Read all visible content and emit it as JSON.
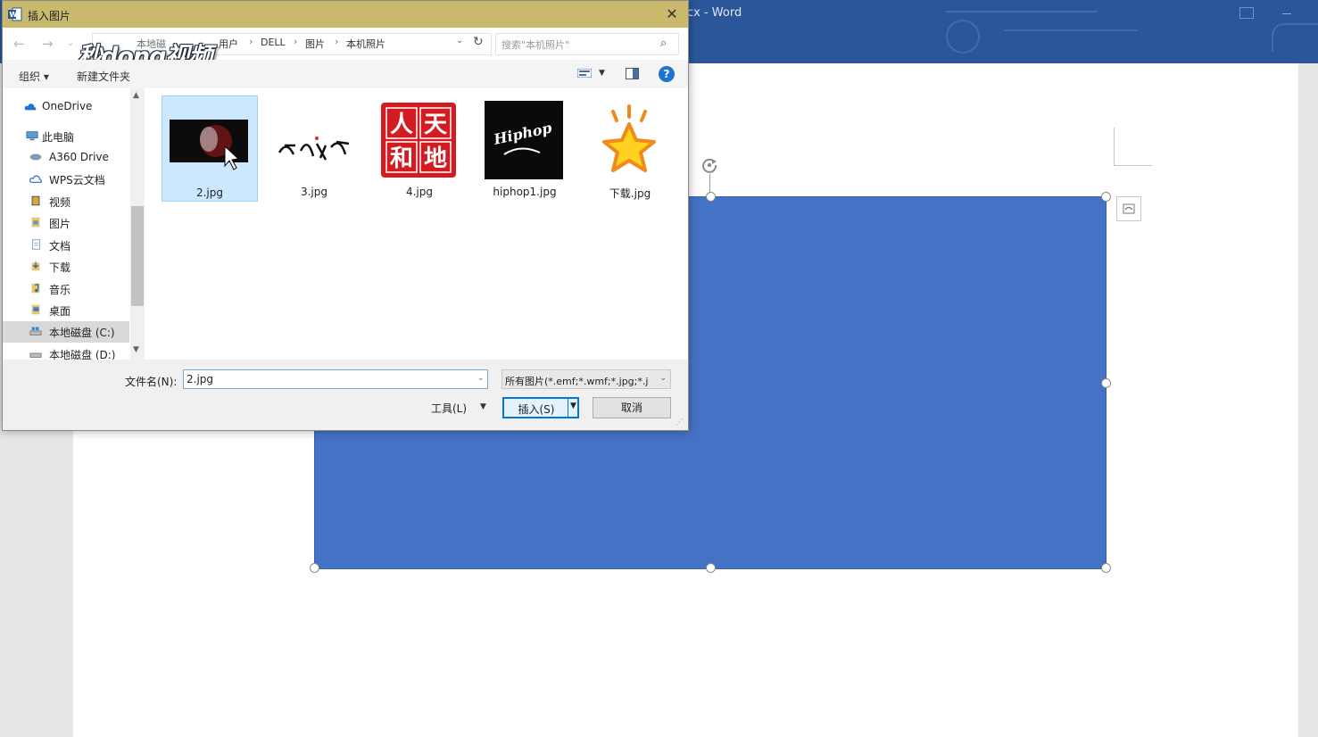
{
  "word": {
    "title": "cx  -  Word"
  },
  "dialog": {
    "title": "插入图片",
    "close_label": "✕",
    "watermark": "秒dong视频",
    "breadcrumb_prefix": "本地磁",
    "breadcrumbs": [
      "用户",
      "DELL",
      "图片",
      "本机照片"
    ],
    "search_placeholder": "搜索\"本机照片\"",
    "toolbar": {
      "organize_label": "组织 ▾",
      "new_folder_label": "新建文件夹",
      "help_label": "?"
    },
    "sidebar": {
      "items": [
        {
          "label": "OneDrive",
          "icon": "cloud-icon"
        },
        {
          "label": "此电脑",
          "icon": "computer-icon"
        },
        {
          "label": "A360 Drive",
          "icon": "a360-drive-icon"
        },
        {
          "label": "WPS云文档",
          "icon": "wps-cloud-icon"
        },
        {
          "label": "视频",
          "icon": "video-folder-icon"
        },
        {
          "label": "图片",
          "icon": "pictures-folder-icon"
        },
        {
          "label": "文档",
          "icon": "documents-folder-icon"
        },
        {
          "label": "下载",
          "icon": "downloads-folder-icon"
        },
        {
          "label": "音乐",
          "icon": "music-folder-icon"
        },
        {
          "label": "桌面",
          "icon": "desktop-folder-icon"
        },
        {
          "label": "本地磁盘 (C:)",
          "icon": "drive-icon",
          "selected": true
        },
        {
          "label": "本地磁盘 (D:)",
          "icon": "drive-icon"
        }
      ]
    },
    "files": [
      {
        "name": "2.jpg",
        "selected": true
      },
      {
        "name": "3.jpg"
      },
      {
        "name": "4.jpg",
        "seal_chars": [
          "人",
          "天",
          "和",
          "地"
        ]
      },
      {
        "name": "hiphop1.jpg",
        "logo_text": "Hiphop"
      },
      {
        "name": "下载.jpg"
      }
    ],
    "footer": {
      "filename_label": "文件名(N):",
      "filename_value": "2.jpg",
      "filetype_value": "所有图片(*.emf;*.wmf;*.jpg;*.j",
      "tools_label": "工具(L)",
      "insert_label": "插入(S)",
      "cancel_label": "取消"
    }
  },
  "colors": {
    "word_blue": "#2b579a",
    "shape_fill": "#4472c4",
    "dialog_titlebar": "#c8b96c",
    "selection": "#cce8ff",
    "accent": "#0078d7"
  }
}
